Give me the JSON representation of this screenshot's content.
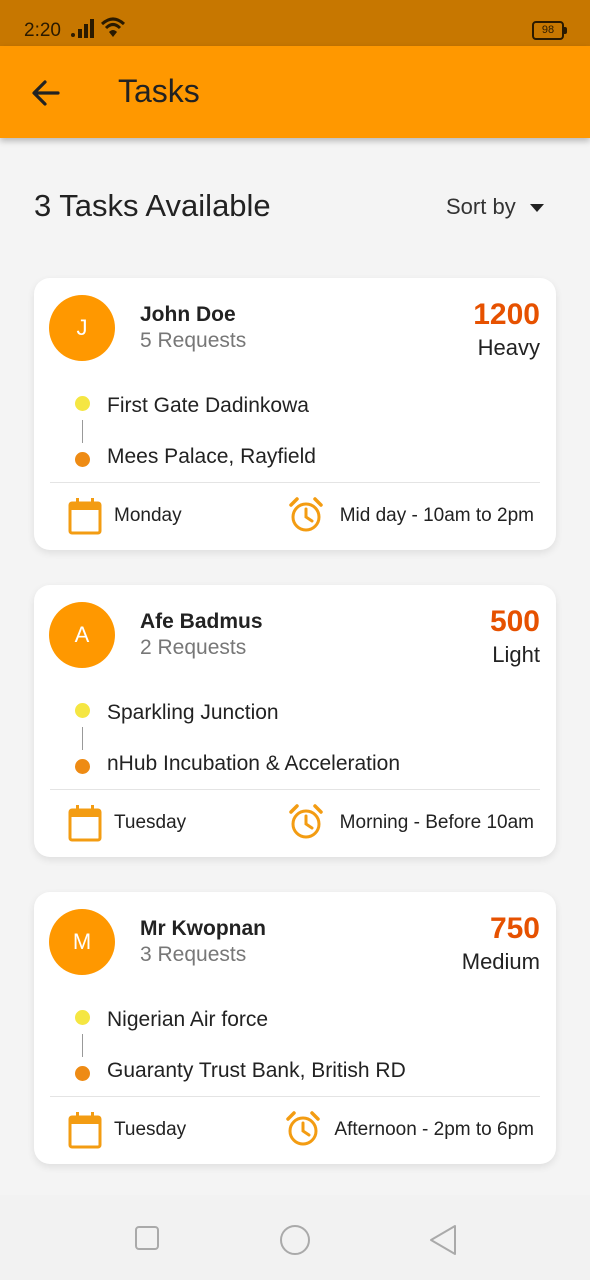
{
  "status_bar": {
    "time": "2:20",
    "battery": "98"
  },
  "app_bar": {
    "title": "Tasks"
  },
  "summary": {
    "text": "3 Tasks Available",
    "sort_label": "Sort by"
  },
  "colors": {
    "accent": "#ff9800",
    "price": "#e65100",
    "start_dot": "#f5e642",
    "end_dot": "#ee8b14"
  },
  "tasks": [
    {
      "initial": "J",
      "name": "John Doe",
      "requests": "5 Requests",
      "price": "1200",
      "weight": "Heavy",
      "from": "First Gate Dadinkowa",
      "to": "Mees Palace, Rayfield",
      "day": "Monday",
      "time": "Mid day - 10am to 2pm"
    },
    {
      "initial": "A",
      "name": "Afe Badmus",
      "requests": "2 Requests",
      "price": "500",
      "weight": "Light",
      "from": "Sparkling Junction",
      "to": "nHub Incubation & Acceleration",
      "day": "Tuesday",
      "time": "Morning - Before 10am"
    },
    {
      "initial": "M",
      "name": "Mr Kwopnan",
      "requests": "3 Requests",
      "price": "750",
      "weight": "Medium",
      "from": "Nigerian Air force",
      "to": "Guaranty Trust Bank, British RD",
      "day": "Tuesday",
      "time": "Afternoon - 2pm to 6pm"
    }
  ],
  "icons": {
    "back": "arrow-left-icon",
    "calendar": "calendar-icon",
    "clock": "alarm-clock-icon",
    "nav_recent": "square-icon",
    "nav_home": "circle-icon",
    "nav_back": "triangle-back-icon"
  }
}
